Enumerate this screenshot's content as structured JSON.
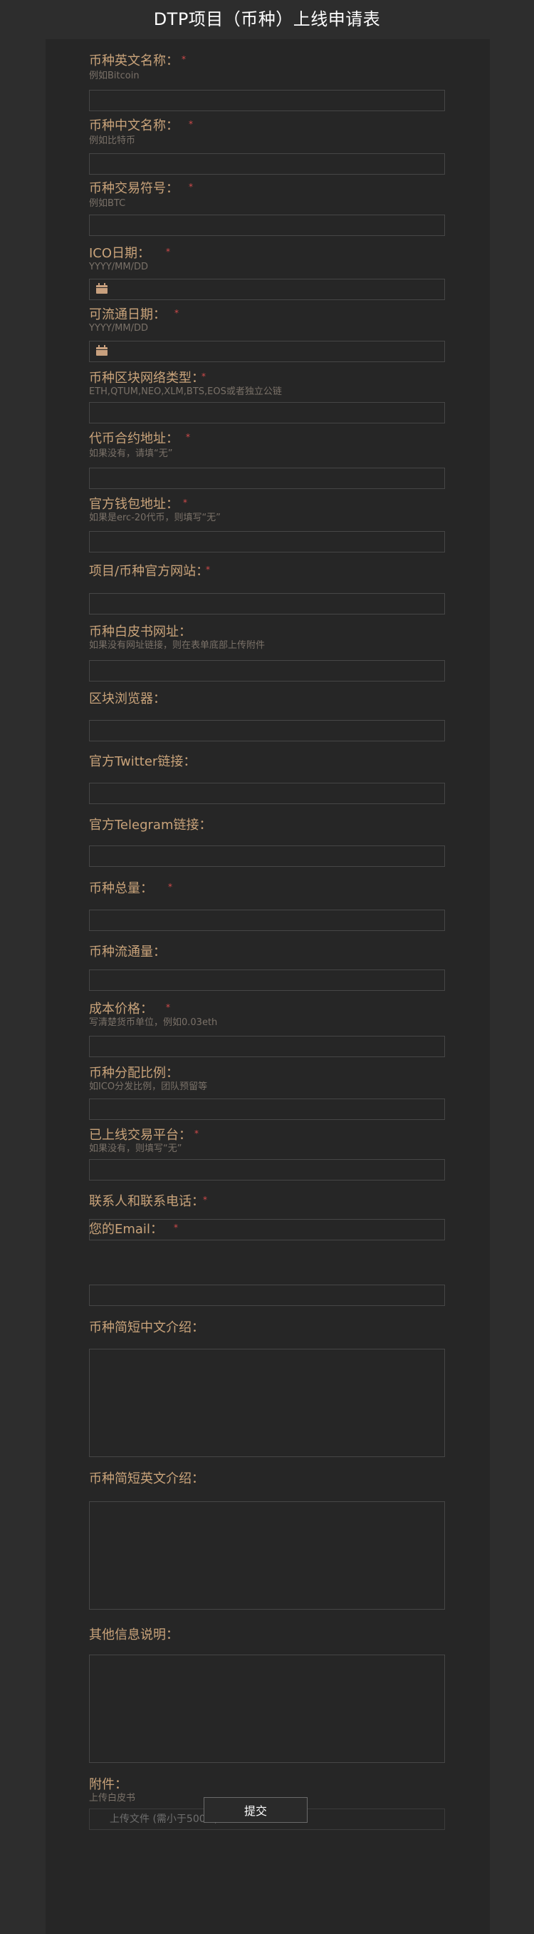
{
  "header": {
    "title": "DTP项目（币种）上线申请表"
  },
  "fields": {
    "name_en": {
      "label": "币种英文名称：",
      "required": "*",
      "hint": "例如Bitcoin",
      "value": ""
    },
    "name_cn": {
      "label": "币种中文名称：",
      "required": "*",
      "hint": "例如比特币",
      "value": ""
    },
    "symbol": {
      "label": "币种交易符号：",
      "required": "*",
      "hint": "例如BTC",
      "value": ""
    },
    "ico_date": {
      "label": "ICO日期：",
      "required": "*",
      "hint": "YYYY/MM/DD",
      "icon": "calendar-icon",
      "value": ""
    },
    "circulation_date": {
      "label": "可流通日期：",
      "required": "*",
      "hint": "YYYY/MM/DD",
      "icon": "calendar-icon",
      "value": ""
    },
    "network_type": {
      "label": "币种区块网络类型：",
      "required": "*",
      "hint": "ETH,QTUM,NEO,XLM,BTS,EOS或者独立公链",
      "value": ""
    },
    "contract_address": {
      "label": "代币合约地址：",
      "required": "*",
      "hint": "如果没有，请填“无”",
      "value": ""
    },
    "wallet_address": {
      "label": "官方钱包地址：",
      "required": "*",
      "hint": "如果是erc-20代币，则填写“无”",
      "value": ""
    },
    "website": {
      "label": "项目/币种官方网站：",
      "required": "*",
      "value": ""
    },
    "whitepaper": {
      "label": "币种白皮书网址：",
      "hint": "如果没有网址链接，则在表单底部上传附件",
      "value": ""
    },
    "explorer": {
      "label": "区块浏览器：",
      "value": ""
    },
    "twitter": {
      "label": "官方Twitter链接：",
      "value": ""
    },
    "telegram": {
      "label": "官方Telegram链接：",
      "value": ""
    },
    "total_supply": {
      "label": "币种总量：",
      "required": "*",
      "value": ""
    },
    "circulating_supply": {
      "label": "币种流通量：",
      "value": ""
    },
    "cost_price": {
      "label": "成本价格：",
      "required": "*",
      "hint": "写清楚货币单位，例如0.03eth",
      "value": ""
    },
    "distribution": {
      "label": "币种分配比例：",
      "hint": "如ICO分发比例，团队预留等",
      "value": ""
    },
    "exchanges": {
      "label": "已上线交易平台：",
      "required": "*",
      "hint": "如果没有，则填写“无”",
      "value": ""
    },
    "contact": {
      "label": "联系人和联系电话：",
      "required": "*",
      "value": ""
    },
    "email": {
      "label": "您的Email：",
      "required": "*",
      "value": ""
    },
    "intro_cn": {
      "label": "币种简短中文介绍：",
      "value": ""
    },
    "intro_en": {
      "label": "币种简短英文介绍：",
      "value": ""
    },
    "other_info": {
      "label": "其他信息说明：",
      "value": ""
    },
    "attachment": {
      "label": "附件：",
      "hint": "上传白皮书",
      "upload_label": "上传文件 (需小于500M)"
    }
  },
  "submit": {
    "label": "提交"
  }
}
